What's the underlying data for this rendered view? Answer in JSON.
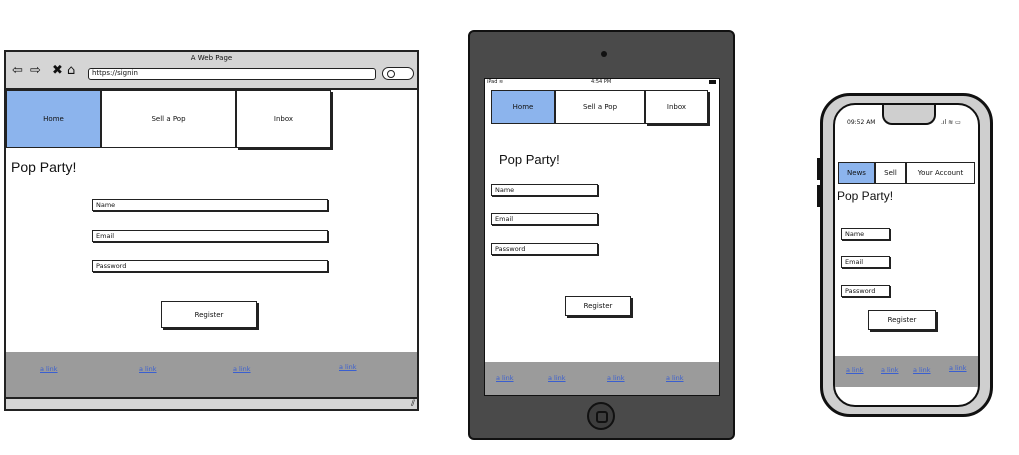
{
  "desktop": {
    "window_title": "A Web Page",
    "url": "https://signin",
    "nav_icons": [
      "back-arrow-icon",
      "forward-arrow-icon",
      "close-icon",
      "home-icon"
    ],
    "tabs": [
      "Home",
      "Sell a Pop",
      "Inbox"
    ],
    "heading": "Pop Party!",
    "fields": [
      "Name",
      "Email",
      "Password"
    ],
    "button": "Register",
    "links": [
      "a link",
      "a link",
      "a link",
      "a link"
    ]
  },
  "tablet": {
    "status_left": "iPad",
    "status_time": "4:54 PM",
    "tabs": [
      "Home",
      "Sell a Pop",
      "Inbox"
    ],
    "heading": "Pop Party!",
    "fields": [
      "Name",
      "Email",
      "Password"
    ],
    "button": "Register",
    "links": [
      "a link",
      "a link",
      "a link",
      "a link"
    ]
  },
  "phone": {
    "status_time": "09:52 AM",
    "tabs": [
      "News",
      "Sell",
      "Your Account"
    ],
    "heading": "Pop Party!",
    "fields": [
      "Name",
      "Email",
      "Password"
    ],
    "button": "Register",
    "links": [
      "a link",
      "a link",
      "a link",
      "a link"
    ]
  },
  "colors": {
    "active_tab": "#8cb4ed",
    "footer": "#9b9b9b",
    "link": "#3a5fd0",
    "device_frame": "#4a4a4a"
  }
}
